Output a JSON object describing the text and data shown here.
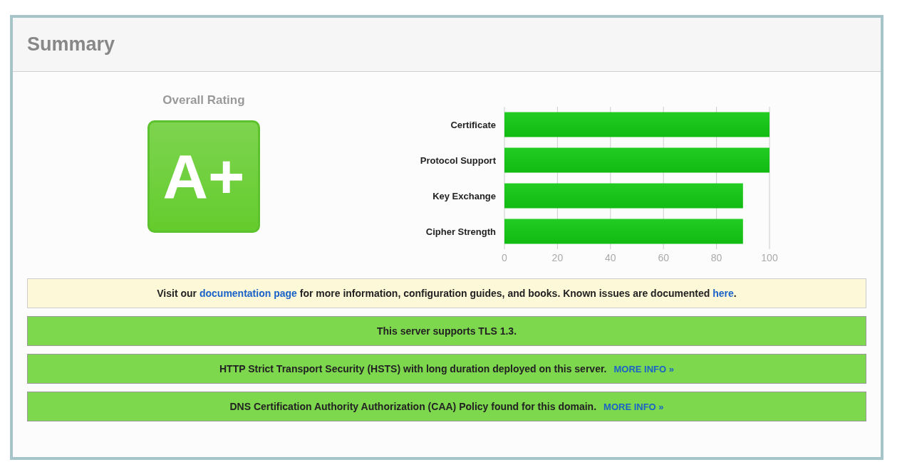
{
  "title": "Summary",
  "rating": {
    "label": "Overall Rating",
    "grade": "A+"
  },
  "chart_data": {
    "type": "bar",
    "orientation": "horizontal",
    "grid": true,
    "categories": [
      "Certificate",
      "Protocol Support",
      "Key Exchange",
      "Cipher Strength"
    ],
    "series": [
      {
        "color": "#11bb11",
        "values": [
          100,
          100,
          90,
          90
        ]
      }
    ],
    "xlim": [
      0,
      100
    ],
    "xticks": [
      0,
      20,
      40,
      60,
      80,
      100
    ]
  },
  "notices": [
    {
      "kind": "info",
      "parts": [
        {
          "kind": "text",
          "text": "Visit our "
        },
        {
          "kind": "link",
          "text": "documentation page"
        },
        {
          "kind": "text",
          "text": " for more information, configuration guides, and books. Known issues are documented "
        },
        {
          "kind": "link",
          "text": "here"
        },
        {
          "kind": "text",
          "text": "."
        }
      ]
    },
    {
      "kind": "success",
      "parts": [
        {
          "kind": "text",
          "text": "This server supports TLS 1.3."
        }
      ]
    },
    {
      "kind": "success",
      "parts": [
        {
          "kind": "text",
          "text": "HTTP Strict Transport Security (HSTS) with long duration deployed on this server."
        },
        {
          "kind": "link",
          "text": "MORE INFO »"
        }
      ]
    },
    {
      "kind": "success",
      "parts": [
        {
          "kind": "text",
          "text": "DNS Certification Authority Authorization (CAA) Policy found for this domain."
        },
        {
          "kind": "link",
          "text": "MORE INFO »"
        }
      ]
    }
  ]
}
